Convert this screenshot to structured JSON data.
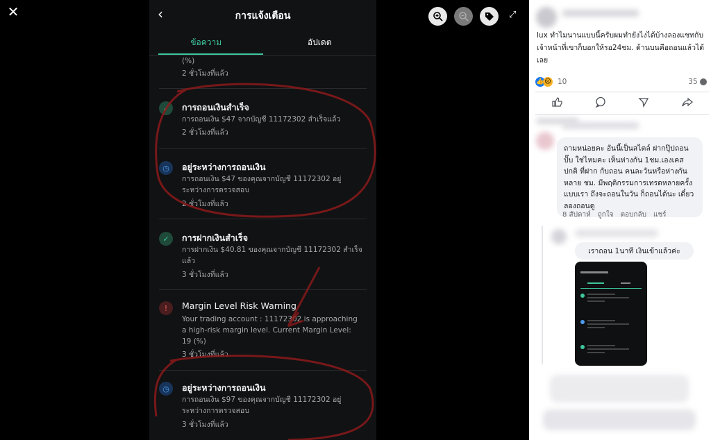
{
  "viewer": {
    "close_icon": "close-icon",
    "tools": [
      "zoom-in-icon",
      "zoom-out-icon",
      "tag-icon"
    ],
    "expand_icon": "expand-icon"
  },
  "phone": {
    "title": "การแจ้งเตือน",
    "tabs": [
      "ข้อความ",
      "อัปเดต"
    ],
    "active_tab": 0,
    "accent_color": "#3ec79e",
    "items": [
      {
        "title": "",
        "body": "(%)",
        "time": "2 ชั่วโมงที่แล้ว",
        "icon": "none"
      },
      {
        "title": "การถอนเงินสำเร็จ",
        "body": "การถอนเงิน $47 จากบัญชี 11172302 สำเร็จแล้ว",
        "time": "2 ชั่วโมงที่แล้ว",
        "icon": "check-icon"
      },
      {
        "title": "อยู่ระหว่างการถอนเงิน",
        "body": "การถอนเงิน $47 ของคุณจากบัญชี 11172302 อยู่ระหว่างการตรวจสอบ",
        "time": "2 ชั่วโมงที่แล้ว",
        "icon": "clock-icon"
      },
      {
        "title": "การฝากเงินสำเร็จ",
        "body": "การฝากเงิน $40.81 ของคุณจากบัญชี 11172302 สำเร็จแล้ว",
        "time": "3 ชั่วโมงที่แล้ว",
        "icon": "check-icon"
      },
      {
        "title": "Margin Level Risk Warning",
        "body": "Your trading account : 11172302 is approaching a high-risk margin level. Current Margin Level: 19 (%)",
        "time": "3 ชั่วโมงที่แล้ว",
        "icon": "alert-icon"
      },
      {
        "title": "อยู่ระหว่างการถอนเงิน",
        "body": "การถอนเงิน $97 ของคุณจากบัญชี 11172302 อยู่ระหว่างการตรวจสอบ",
        "time": "3 ชั่วโมงที่แล้ว",
        "icon": "clock-icon"
      }
    ]
  },
  "post": {
    "text": "lux ทำไมนานแบบนี้ครับผมทำยังไงได้บ้างลองแชทกับเจ้าหน้าที่เขาก็บอกให้รอ24ชม. ด้านบนคือถอนแล้วได้เลย",
    "reaction_count": "10",
    "comment_count": "35",
    "actions": [
      "like-icon",
      "comment-icon",
      "send-icon",
      "share-icon"
    ]
  },
  "comment": {
    "text": "ถามหน่อยคะ อันนี้เป็นสไตล์ ฝากปุ๊ปถอนปั๊บ ใช่ไหมคะ เห็นห่างกัน 1ชม.เองเคสปกติ ที่ฝาก กับถอน คนละวันหรือห่างกันหลาย ชม. มีพฤติกรรมการเทรดหลายครั้ง แบบเรา ถึงจะถอนในวัน ก็ถอนได้นะ เดี๋ยวลองถอนดู",
    "meta": [
      "8 สัปดาห์",
      "ถูกใจ",
      "ตอบกลับ",
      "แชร์"
    ],
    "reply_text": "เราถอน 1นาที เงินเข้าแล้วค่ะ"
  }
}
